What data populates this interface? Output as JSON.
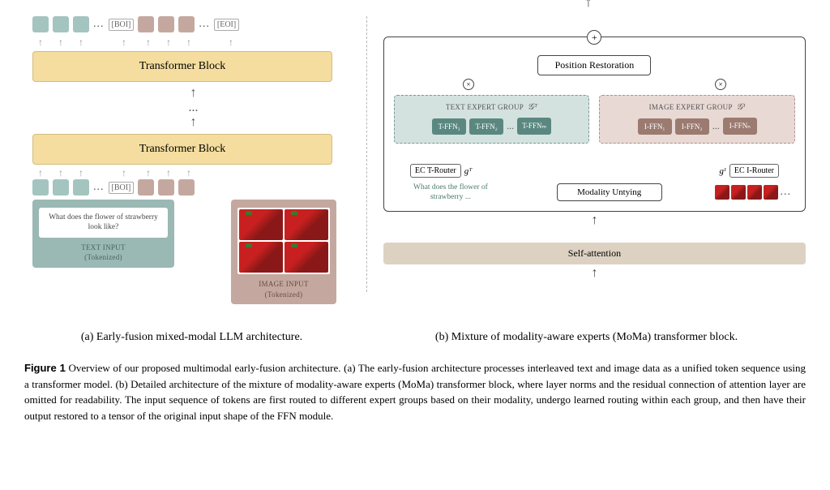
{
  "panelA": {
    "transformerBlock": "Transformer Block",
    "boi": "[BOI]",
    "eoi": "[EOI]",
    "textInputPrompt": "What does the flower of strawberry look like?",
    "textInputLabel1": "TEXT INPUT",
    "textInputLabel2": "(Tokenized)",
    "imageInputLabel1": "IMAGE INPUT",
    "imageInputLabel2": "(Tokenized)",
    "dots": "..."
  },
  "panelB": {
    "positionRestoration": "Position Restoration",
    "textExpertGroup": "TEXT EXPERT GROUP",
    "imageExpertGroup": "IMAGE EXPERT GROUP",
    "gT": "𝒢ᵀ",
    "gI": "𝒢ᴵ",
    "gTsmall": "gᵀ",
    "gIsmall": "gᴵ",
    "tffn1": "T-FFN₁",
    "tffn2": "T-FFN₂",
    "tffnm": "T-FFNₘ",
    "iffn1": "I-FFN₁",
    "iffn2": "I-FFN₂",
    "iffnn": "I-FFNₙ",
    "trouter": "EC T-Router",
    "irouter": "EC I-Router",
    "modalityUntying": "Modality Untying",
    "sampleText": "What does the flower of strawberry ...",
    "selfAttention": "Self-attention",
    "dots": "..."
  },
  "captions": {
    "a": "(a) Early-fusion mixed-modal LLM architecture.",
    "b": "(b) Mixture of modality-aware experts (MoMa) transformer block."
  },
  "figureCaption": {
    "label": "Figure 1",
    "text": " Overview of our proposed multimodal early-fusion architecture. (a) The early-fusion architecture processes interleaved text and image data as a unified token sequence using a transformer model. (b) Detailed architecture of the mixture of modality-aware experts (MoMa) transformer block, where layer norms and the residual connection of attention layer are omitted for readability. The input sequence of tokens are first routed to different expert groups based on their modality, undergo learned routing within each group, and then have their output restored to a tensor of the original input shape of the FFN module."
  }
}
